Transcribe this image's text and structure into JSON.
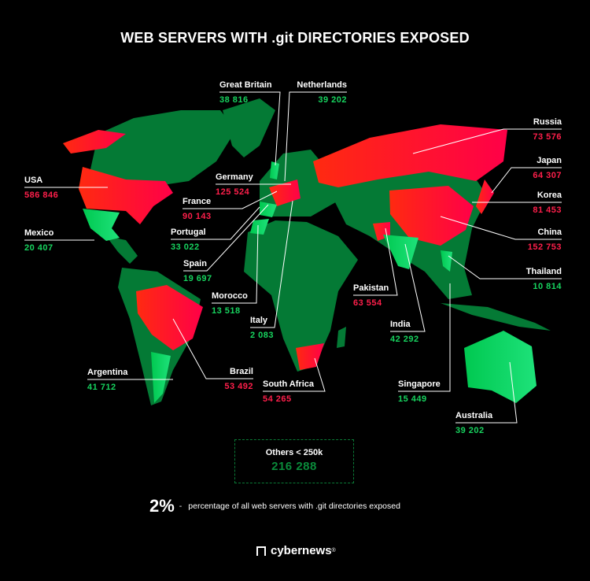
{
  "title": "WEB SERVERS WITH .git DIRECTORIES EXPOSED",
  "colors": {
    "background": "#000000",
    "high": "#ff1a2e",
    "medium": "#00d45f",
    "low": "#047a35",
    "value_red": "#ff1f4b",
    "value_green": "#17d45f"
  },
  "countries": [
    {
      "name": "Great Britain",
      "value": "38 816",
      "level": "medium"
    },
    {
      "name": "Netherlands",
      "value": "39 202",
      "level": "medium"
    },
    {
      "name": "Germany",
      "value": "125 524",
      "level": "high"
    },
    {
      "name": "France",
      "value": "90 143",
      "level": "high"
    },
    {
      "name": "Portugal",
      "value": "33 022",
      "level": "medium"
    },
    {
      "name": "Spain",
      "value": "19 697",
      "level": "medium"
    },
    {
      "name": "Morocco",
      "value": "13 518",
      "level": "medium"
    },
    {
      "name": "Italy",
      "value": "2 083",
      "level": "medium"
    },
    {
      "name": "USA",
      "value": "586 846",
      "level": "high"
    },
    {
      "name": "Mexico",
      "value": "20 407",
      "level": "medium"
    },
    {
      "name": "Argentina",
      "value": "41 712",
      "level": "medium"
    },
    {
      "name": "Brazil",
      "value": "53 492",
      "level": "high"
    },
    {
      "name": "South Africa",
      "value": "54 265",
      "level": "high"
    },
    {
      "name": "Pakistan",
      "value": "63 554",
      "level": "high"
    },
    {
      "name": "India",
      "value": "42 292",
      "level": "medium"
    },
    {
      "name": "Singapore",
      "value": "15 449",
      "level": "medium"
    },
    {
      "name": "Australia",
      "value": "39 202",
      "level": "medium"
    },
    {
      "name": "Russia",
      "value": "73 576",
      "level": "high"
    },
    {
      "name": "Japan",
      "value": "64 307",
      "level": "high"
    },
    {
      "name": "Korea",
      "value": "81 453",
      "level": "high"
    },
    {
      "name": "China",
      "value": "152 753",
      "level": "high"
    },
    {
      "name": "Thailand",
      "value": "10 814",
      "level": "medium"
    }
  ],
  "others": {
    "label": "Others",
    "threshold": "< 250k",
    "value": "216 288"
  },
  "stat": {
    "value": "2%",
    "separator": "-",
    "text": "percentage of all web servers with .git directories exposed"
  },
  "brand": {
    "name": "cybernews",
    "mark": "®"
  }
}
